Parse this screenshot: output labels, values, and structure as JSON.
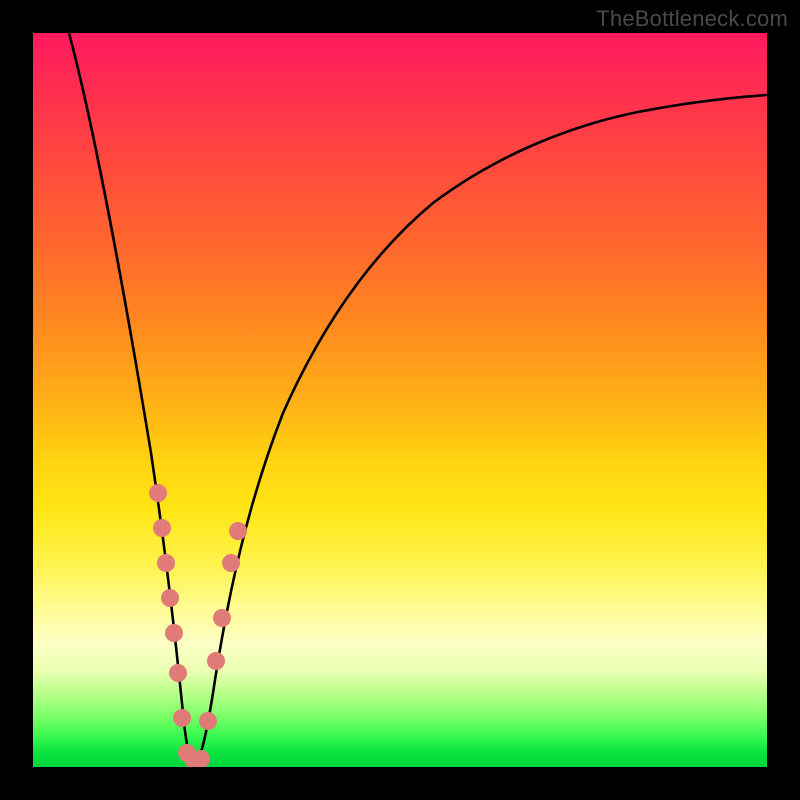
{
  "watermark": "TheBottleneck.com",
  "chart_data": {
    "type": "line",
    "title": "",
    "xlabel": "",
    "ylabel": "",
    "xlim": [
      0,
      100
    ],
    "ylim": [
      0,
      100
    ],
    "notes": "Background is a vertical gradient indicating bottleneck severity: green (≈0, bottom) → yellow → orange → red/magenta (≈100, top). A black V-shaped curve shows bottleneck percentage with a minimum near x≈21. Pink round markers cluster near the minimum.",
    "series": [
      {
        "name": "bottleneck-curve",
        "x": [
          5,
          8,
          10,
          12,
          14,
          16,
          18,
          19,
          20,
          21,
          22,
          23,
          24,
          25,
          27,
          30,
          35,
          40,
          45,
          50,
          55,
          60,
          65,
          70,
          75,
          80,
          85,
          90,
          95,
          100
        ],
        "y": [
          100,
          88,
          78,
          68,
          57,
          45,
          30,
          21,
          11,
          2,
          2,
          8,
          14,
          20,
          29,
          40,
          52,
          60,
          66,
          71,
          75,
          78,
          81,
          83,
          85,
          86,
          87,
          88,
          88.5,
          89
        ]
      }
    ],
    "markers": {
      "name": "highlighted-points",
      "color": "#e07b78",
      "points": [
        {
          "x": 17.0,
          "y": 37
        },
        {
          "x": 17.6,
          "y": 32
        },
        {
          "x": 18.2,
          "y": 27
        },
        {
          "x": 18.8,
          "y": 22
        },
        {
          "x": 19.3,
          "y": 17
        },
        {
          "x": 19.7,
          "y": 12
        },
        {
          "x": 20.3,
          "y": 6
        },
        {
          "x": 20.9,
          "y": 2
        },
        {
          "x": 21.7,
          "y": 2
        },
        {
          "x": 22.4,
          "y": 2
        },
        {
          "x": 23.2,
          "y": 8
        },
        {
          "x": 24.3,
          "y": 16
        },
        {
          "x": 25.2,
          "y": 21
        },
        {
          "x": 26.6,
          "y": 28
        },
        {
          "x": 27.6,
          "y": 32
        }
      ]
    },
    "gradient_stops": [
      {
        "pos": 0,
        "color": "#ff1a5e"
      },
      {
        "pos": 50,
        "color": "#ffb017"
      },
      {
        "pos": 78,
        "color": "#fffb8d"
      },
      {
        "pos": 100,
        "color": "#00d63e"
      }
    ]
  }
}
